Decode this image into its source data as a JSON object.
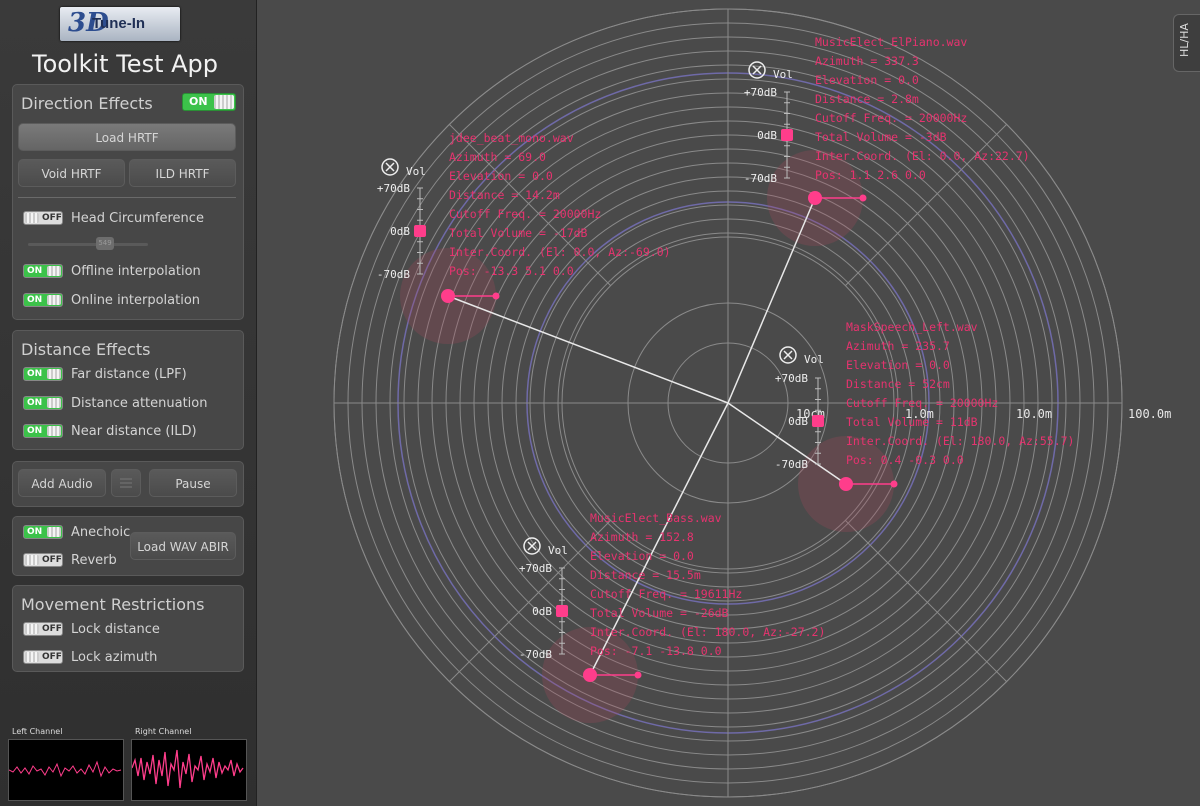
{
  "logo": {
    "mark": "3D",
    "text": "Tune-In"
  },
  "app_title": "Toolkit Test App",
  "direction": {
    "title": "Direction Effects",
    "toggle": "ON",
    "load_hrtf": "Load HRTF",
    "void_hrtf": "Void HRTF",
    "ild_hrtf": "ILD HRTF",
    "head_circ_toggle": "OFF",
    "head_circ_label": "Head Circumference",
    "slider_value": "549",
    "offline_toggle": "ON",
    "offline_label": "Offline interpolation",
    "online_toggle": "ON",
    "online_label": "Online interpolation"
  },
  "distance": {
    "title": "Distance Effects",
    "far_toggle": "ON",
    "far_label": "Far distance (LPF)",
    "atten_toggle": "ON",
    "atten_label": "Distance attenuation",
    "near_toggle": "ON",
    "near_label": "Near distance (ILD)"
  },
  "controls": {
    "add_audio": "Add Audio",
    "pause": "Pause"
  },
  "environment": {
    "anechoic_toggle": "ON",
    "anechoic_label": "Anechoic",
    "reverb_toggle": "OFF",
    "reverb_label": "Reverb",
    "load_abir": "Load WAV ABIR"
  },
  "movement": {
    "title": "Movement Restrictions",
    "lock_distance_toggle": "OFF",
    "lock_distance_label": "Lock distance",
    "lock_azimuth_toggle": "OFF",
    "lock_azimuth_label": "Lock azimuth"
  },
  "channels": {
    "left": "Left Channel",
    "right": "Right Channel"
  },
  "hl_tab": "HL/HA",
  "radar": {
    "scale_labels": [
      "10cm",
      "1.0m",
      "10.0m",
      "100.0m"
    ],
    "vol_label": "Vol",
    "vol_max": "+70dB",
    "vol_mid": "0dB",
    "vol_min": "-70dB"
  },
  "sources": [
    {
      "lines": [
        "MusicElect_ElPiano.wav",
        "Azimuth = 337.3",
        "Elevation = 0.0",
        "Distance = 2.8m",
        "Cutoff Freq. = 20000Hz",
        "Total Volume = -3dB",
        "Inter.Coord. (El: 0.0, Az:22.7)",
        "Pos: 1.1 2.6 0.0"
      ],
      "volume_db": 0
    },
    {
      "lines": [
        "jdee_beat_mono.wav",
        "Azimuth = 69.0",
        "Elevation = 0.0",
        "Distance = 14.2m",
        "Cutoff Freq. = 20000Hz",
        "Total Volume = -17dB",
        "Inter.Coord. (El: 0.0, Az:-69.0)",
        "Pos: -13.3 5.1 0.0"
      ],
      "volume_db": 0
    },
    {
      "lines": [
        "MaskSpeech_Left.wav",
        "Azimuth = 235.7",
        "Elevation = 0.0",
        "Distance = 52cm",
        "Cutoff Freq. = 20000Hz",
        "Total Volume = 11dB",
        "Inter.Coord. (El: 180.0, Az:55.7)",
        "Pos: 0.4 -0.3 0.0"
      ],
      "volume_db": 0
    },
    {
      "lines": [
        "MusicElect_Bass.wav",
        "Azimuth = 152.8",
        "Elevation = 0.0",
        "Distance = 15.5m",
        "Cutoff Freq. = 19611Hz",
        "Total Volume = -26dB",
        "Inter.Coord. (El: 180.0, Az:-27.2)",
        "Pos: -7.1 -13.8 0.0"
      ],
      "volume_db": 0
    }
  ],
  "colors": {
    "accent": "#ff3d8b",
    "text": "#e6336f",
    "toggle_on": "#3cc24a"
  }
}
